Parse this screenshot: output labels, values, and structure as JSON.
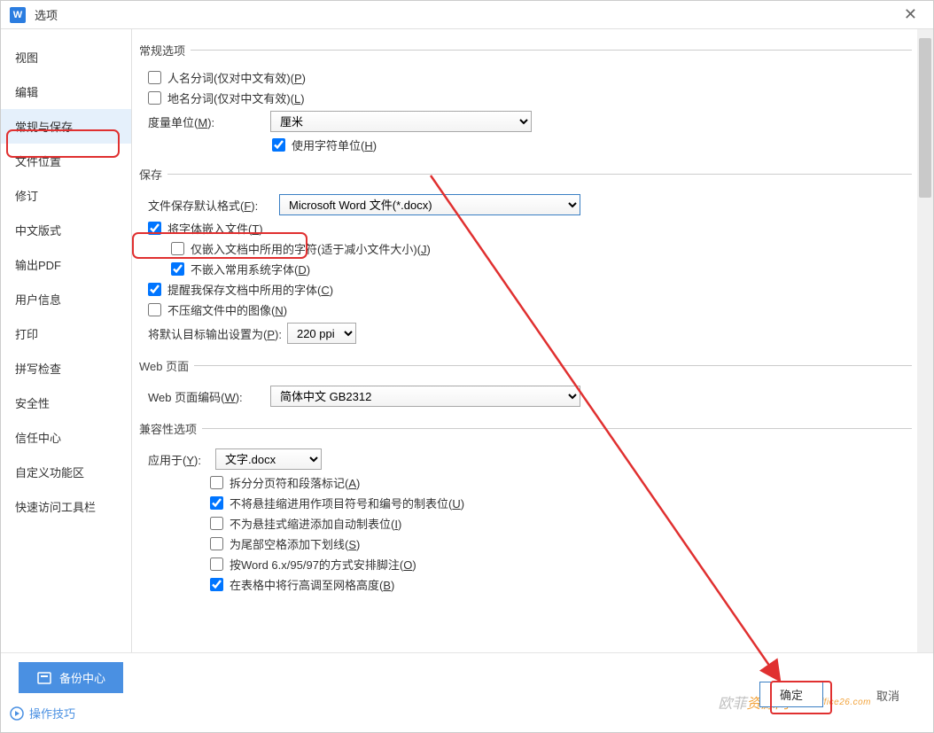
{
  "title": "选项",
  "sidebar": {
    "items": [
      {
        "label": "视图"
      },
      {
        "label": "编辑"
      },
      {
        "label": "常规与保存",
        "selected": true
      },
      {
        "label": "文件位置"
      },
      {
        "label": "修订"
      },
      {
        "label": "中文版式"
      },
      {
        "label": "输出PDF"
      },
      {
        "label": "用户信息"
      },
      {
        "label": "打印"
      },
      {
        "label": "拼写检查"
      },
      {
        "label": "安全性"
      },
      {
        "label": "信任中心"
      },
      {
        "label": "自定义功能区"
      },
      {
        "label": "快速访问工具栏"
      }
    ]
  },
  "sections": {
    "general": {
      "legend": "常规选项",
      "personName": {
        "label_a": "人名分词(仅对中文有效)(",
        "key": "P",
        "label_b": ")",
        "checked": false
      },
      "placeName": {
        "label_a": "地名分词(仅对中文有效)(",
        "key": "L",
        "label_b": ")",
        "checked": false
      },
      "unit": {
        "label_a": "度量单位(",
        "key": "M",
        "label_b": "):",
        "value": "厘米"
      },
      "charUnit": {
        "label_a": "使用字符单位(",
        "key": "H",
        "label_b": ")",
        "checked": true
      }
    },
    "save": {
      "legend": "保存",
      "defaultFormat": {
        "label_a": "文件保存默认格式(",
        "key": "F",
        "label_b": "):",
        "value": "Microsoft Word 文件(*.docx)"
      },
      "embedFont": {
        "label_a": "将字体嵌入文件(",
        "key": "T",
        "label_b": ")",
        "checked": true
      },
      "embedUsed": {
        "label_a": "仅嵌入文档中所用的字符(适于减小文件大小)(",
        "key": "J",
        "label_b": ")",
        "checked": false
      },
      "noCommon": {
        "label_a": "不嵌入常用系统字体(",
        "key": "D",
        "label_b": ")",
        "checked": true
      },
      "remind": {
        "label_a": "提醒我保存文档中所用的字体(",
        "key": "C",
        "label_b": ")",
        "checked": true
      },
      "noCompress": {
        "label_a": "不压缩文件中的图像(",
        "key": "N",
        "label_b": ")",
        "checked": false
      },
      "targetPpi": {
        "label_a": "将默认目标输出设置为(",
        "key": "P",
        "label_b": "):",
        "value": "220 ppi"
      }
    },
    "web": {
      "legend": "Web 页面",
      "encoding": {
        "label_a": "Web 页面编码(",
        "key": "W",
        "label_b": "):",
        "value": "简体中文 GB2312"
      }
    },
    "compat": {
      "legend": "兼容性选项",
      "applyTo": {
        "label_a": "应用于(",
        "key": "Y",
        "label_b": "):",
        "value": "文字.docx"
      },
      "items": [
        {
          "label_a": "拆分分页符和段落标记(",
          "key": "A",
          "label_b": ")",
          "checked": false
        },
        {
          "label_a": "不将悬挂缩进用作项目符号和编号的制表位(",
          "key": "U",
          "label_b": ")",
          "checked": true
        },
        {
          "label_a": "不为悬挂式缩进添加自动制表位(",
          "key": "I",
          "label_b": ")",
          "checked": false
        },
        {
          "label_a": "为尾部空格添加下划线(",
          "key": "S",
          "label_b": ")",
          "checked": false
        },
        {
          "label_a": "按Word 6.x/95/97的方式安排脚注(",
          "key": "O",
          "label_b": ")",
          "checked": false
        },
        {
          "label_a": "在表格中将行高调至网格高度(",
          "key": "B",
          "label_b": ")",
          "checked": true
        }
      ]
    }
  },
  "bottom": {
    "backup": "备份中心",
    "tips": "操作技巧",
    "ok": "确定",
    "cancel": "取消"
  },
  "watermark": {
    "a": "欧菲",
    "b": "资源网",
    "url": "www.office26.com"
  }
}
